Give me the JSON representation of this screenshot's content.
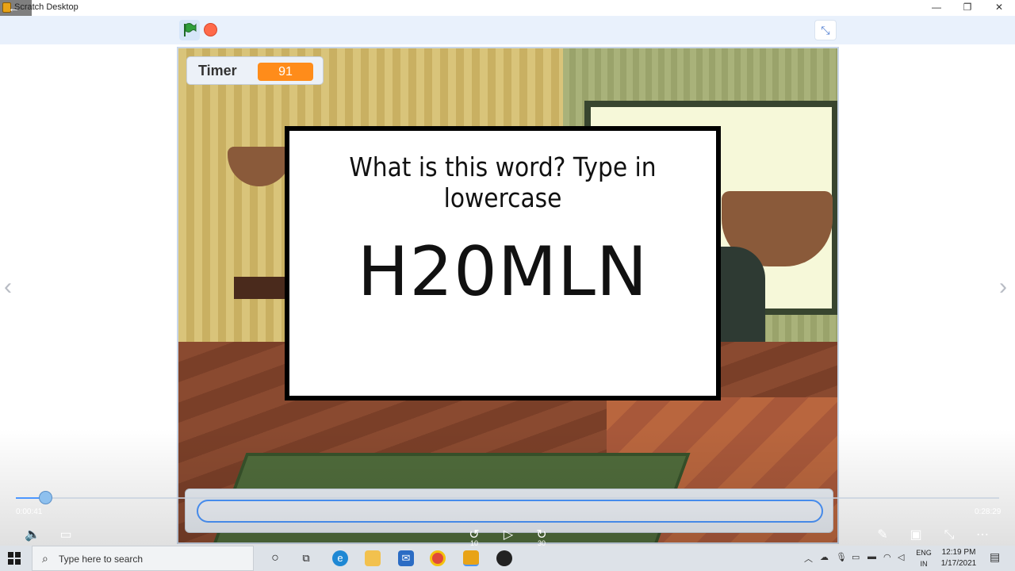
{
  "window": {
    "title": "Scratch Desktop",
    "minimize": "—",
    "maximize": "❐",
    "close": "✕"
  },
  "toolbar": {
    "fullscreen_icon": "⤡"
  },
  "stage": {
    "timer_label": "Timer",
    "timer_value": "91",
    "question": "What is this word? Type in lowercase",
    "word": "H20MLN",
    "answer_value": "",
    "submit_icon": "✔"
  },
  "player": {
    "current_time": "0:00:41",
    "total_time": "0:28:29",
    "progress_fraction": 0.024,
    "rewind_label": "10",
    "forward_label": "30",
    "play_icon": "▷",
    "volume_icon": "🔈",
    "captions_icon": "▭",
    "pen_icon": "✎",
    "cast_icon": "▣",
    "minimize_icon": "⤡",
    "more_icon": "⋯",
    "prev_arrow": "‹",
    "next_arrow": "›"
  },
  "taskbar": {
    "search_placeholder": "Type here to search",
    "lang_line1": "ENG",
    "lang_line2": "IN",
    "time": "12:19 PM",
    "date": "1/17/2021"
  },
  "colors": {
    "accent": "#4c97ff",
    "timer": "#ff8c1a",
    "stop": "#ff6a4a",
    "flag": "#2e9e3a"
  }
}
